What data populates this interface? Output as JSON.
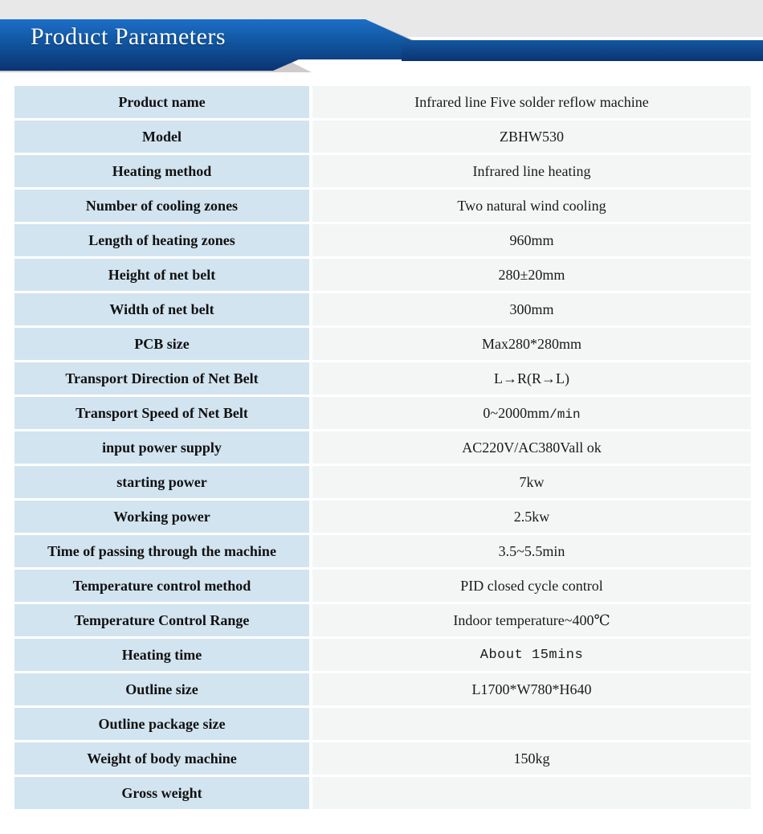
{
  "header": {
    "title": "Product Parameters",
    "banner_color_light": "#1668c4",
    "banner_color_dark": "#0c3b7a",
    "banner_bar_color": "#0d4a92",
    "background_strip_color": "#e8e8e8"
  },
  "table": {
    "label_cell_color": "#d2e4f0",
    "value_cell_color": "#f4f6f6",
    "rows": [
      {
        "label": "Product name",
        "value": "Infrared line Five solder reflow machine",
        "style": "serif"
      },
      {
        "label": "Model",
        "value": "ZBHW530",
        "style": "serif"
      },
      {
        "label": "Heating method",
        "value": "Infrared line heating",
        "style": "serif"
      },
      {
        "label": "Number of cooling zones",
        "value": "Two natural wind cooling",
        "style": "serif"
      },
      {
        "label": "Length of heating zones",
        "value": "960mm",
        "style": "serif"
      },
      {
        "label": "Height of net belt",
        "value": "280±20mm",
        "style": "serif"
      },
      {
        "label": "Width of net belt",
        "value": "300mm",
        "style": "serif"
      },
      {
        "label": "PCB size",
        "value": "Max280*280mm",
        "style": "serif"
      },
      {
        "label": "Transport Direction of Net Belt",
        "value": "L→R(R→L)",
        "style": "serif"
      },
      {
        "label": "Transport Speed of Net Belt",
        "value": "0~2000mm",
        "value_mono_suffix": "/min",
        "style": "mixed"
      },
      {
        "label": "input power supply",
        "value": "AC220V/AC380Vall ok",
        "style": "serif"
      },
      {
        "label": "starting power",
        "value": "7kw",
        "style": "serif"
      },
      {
        "label": "Working power",
        "value": "2.5kw",
        "style": "serif"
      },
      {
        "label": "Time of passing through the machine",
        "value": "3.5~5.5min",
        "style": "serif"
      },
      {
        "label": "Temperature control method",
        "value": "PID closed cycle control",
        "style": "serif"
      },
      {
        "label": "Temperature Control Range",
        "value": "Indoor temperature~400℃",
        "style": "serif"
      },
      {
        "label": "Heating time",
        "value": "About  15mins",
        "style": "mono"
      },
      {
        "label": "Outline size",
        "value": "L1700*W780*H640",
        "style": "serif"
      },
      {
        "label": "Outline package size",
        "value": "",
        "style": "serif"
      },
      {
        "label": "Weight of body machine",
        "value": "150kg",
        "style": "serif"
      },
      {
        "label": "Gross weight",
        "value": "",
        "style": "serif"
      }
    ]
  }
}
